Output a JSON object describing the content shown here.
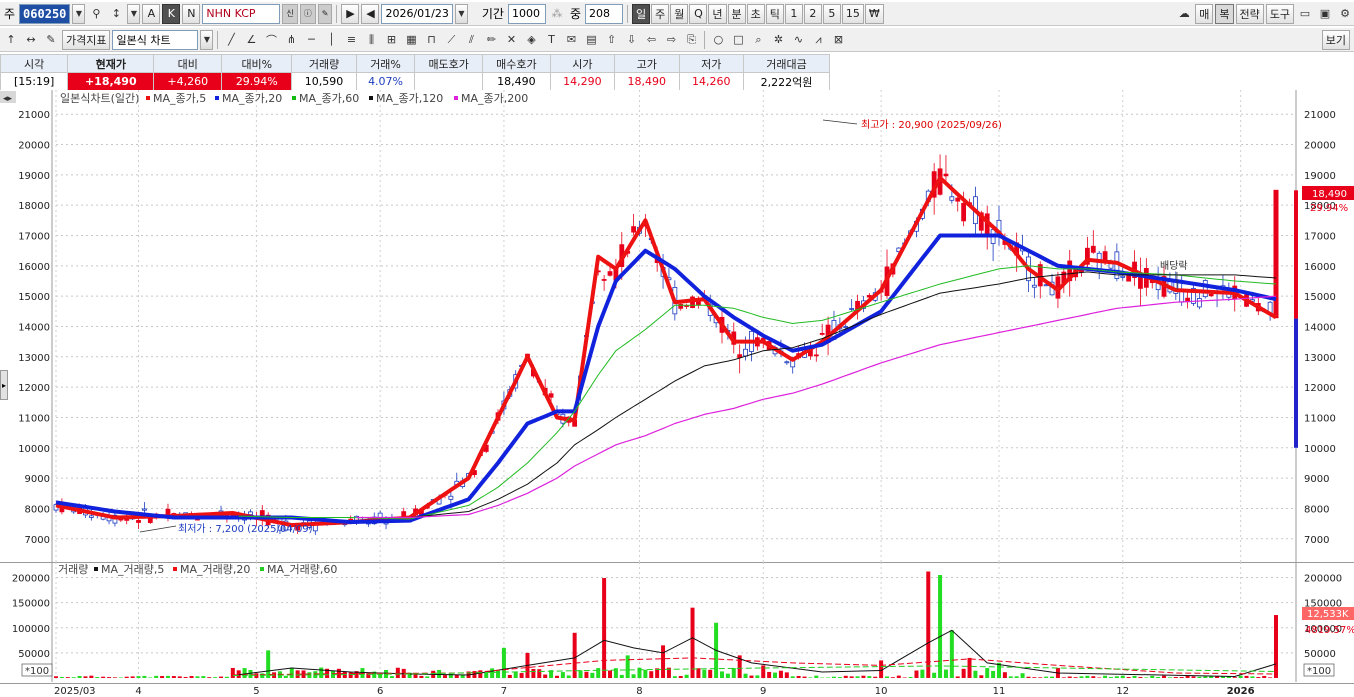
{
  "toolbar": {
    "market_label": "주",
    "stock_code": "060250",
    "stock_name": "NHN KCP",
    "btn_a": "A",
    "btn_k": "K",
    "btn_n": "N",
    "date": "2026/01/23",
    "period_label": "기간",
    "period_value": "1000",
    "count_label": "중",
    "count_value": "208",
    "timeframes": [
      "일",
      "주",
      "월",
      "Q",
      "년",
      "분",
      "초",
      "틱",
      "1",
      "2",
      "5",
      "15",
      "₩"
    ],
    "active_timeframe": "일",
    "right_buttons": [
      "매",
      "복",
      "전략",
      "도구"
    ],
    "price_indicator": "가격지표",
    "chart_type": "일본식 차트",
    "view_button": "보기"
  },
  "quote": {
    "headers": [
      "시각",
      "현재가",
      "대비",
      "대비%",
      "거래량",
      "거래%",
      "매도호가",
      "매수호가",
      "시가",
      "고가",
      "저가",
      "거래대금"
    ],
    "time": "[15:19]",
    "current": "+18,490",
    "change": "+4,260",
    "change_pct": "29.94%",
    "volume": "10,590",
    "volume_pct": "4.07%",
    "ask": "",
    "bid": "18,490",
    "open": "14,290",
    "high": "18,490",
    "low": "14,260",
    "amount": "2,222억원"
  },
  "price_chart": {
    "legend_title": "일본식차트(일간)",
    "legend_items": [
      {
        "name": "MA_종가,5",
        "color": "#ee1111"
      },
      {
        "name": "MA_종가,20",
        "color": "#1122dd"
      },
      {
        "name": "MA_종가,60",
        "color": "#11bb11"
      },
      {
        "name": "MA_종가,120",
        "color": "#111111"
      },
      {
        "name": "MA_종가,200",
        "color": "#dd22dd"
      }
    ],
    "high_annotation": "최고가 : 20,900 (2025/09/26)",
    "low_annotation": "최저가 : 7,200 (2025/04/09)",
    "dividend_label": "배당락",
    "last_price_tag": "18,490",
    "last_pct_tag": "29.94%"
  },
  "volume_chart": {
    "legend_title": "거래량",
    "legend_items": [
      {
        "name": "MA_거래량,5",
        "color": "#111111"
      },
      {
        "name": "MA_거래량,20",
        "color": "#ee1111"
      },
      {
        "name": "MA_거래량,60",
        "color": "#22cc22"
      }
    ],
    "unit_left": "*100",
    "unit_right": "*100",
    "last_volume_tag": "12,533K",
    "last_vol_pct_tag": "4819.57%"
  },
  "chart_data": [
    {
      "type": "line",
      "title": "일본식차트(일간)",
      "ylim": [
        6300,
        21600
      ],
      "y_ticks": [
        7000,
        8000,
        9000,
        10000,
        11000,
        12000,
        13000,
        14000,
        15000,
        16000,
        17000,
        18000,
        19000,
        20000,
        21000
      ],
      "x_ticks": [
        "2025/03",
        "4",
        "5",
        "6",
        "7",
        "8",
        "9",
        "10",
        "11",
        "12",
        "2026"
      ],
      "x": [
        0,
        10,
        20,
        30,
        40,
        50,
        60,
        70,
        75,
        80,
        85,
        88,
        92,
        95,
        100,
        105,
        110,
        115,
        120,
        125,
        130,
        140,
        150,
        160,
        165,
        170,
        175,
        180,
        190,
        200,
        207
      ],
      "series": [
        {
          "name": "MA_종가,5",
          "values": [
            8100,
            7700,
            7750,
            7850,
            7450,
            7550,
            7700,
            9000,
            11000,
            13000,
            11000,
            10900,
            16300,
            15900,
            17500,
            14800,
            14900,
            13500,
            13500,
            12900,
            13500,
            15200,
            18900,
            17100,
            15900,
            15200,
            16200,
            16100,
            15200,
            15100,
            14300
          ]
        },
        {
          "name": "MA_종가,20",
          "values": [
            8200,
            7900,
            7700,
            7700,
            7700,
            7550,
            7600,
            8300,
            9500,
            10800,
            11200,
            11200,
            14000,
            15500,
            16500,
            15900,
            15000,
            14300,
            13700,
            13200,
            13400,
            14500,
            17000,
            17000,
            16500,
            16000,
            15900,
            15800,
            15500,
            15200,
            14900
          ]
        },
        {
          "name": "MA_종가,60",
          "values": [
            null,
            null,
            null,
            7750,
            7700,
            7700,
            7650,
            8100,
            8700,
            9500,
            10500,
            11200,
            12400,
            13200,
            13900,
            14700,
            14700,
            14600,
            14300,
            14100,
            14200,
            14800,
            15400,
            15900,
            16000,
            15900,
            15900,
            15800,
            15700,
            15500,
            15400
          ]
        },
        {
          "name": "MA_종가,120",
          "values": [
            null,
            null,
            null,
            null,
            null,
            7700,
            7700,
            7900,
            8300,
            8800,
            9500,
            10100,
            10600,
            11000,
            11600,
            12200,
            12700,
            12900,
            13200,
            13300,
            13600,
            14400,
            15100,
            15400,
            15600,
            15700,
            15800,
            15700,
            15700,
            15700,
            15600
          ]
        },
        {
          "name": "MA_종가,200",
          "values": [
            null,
            null,
            null,
            null,
            null,
            7700,
            7700,
            7800,
            8100,
            8500,
            9000,
            9400,
            9800,
            10100,
            10400,
            10800,
            11100,
            11300,
            11600,
            11800,
            12100,
            12800,
            13400,
            13800,
            14000,
            14200,
            14400,
            14600,
            14800,
            14900,
            15000
          ]
        }
      ],
      "annotations": {
        "max": 20900,
        "max_date": "2025/09/26",
        "min": 7200,
        "min_date": "2025/04/09",
        "last_close": 18490
      }
    },
    {
      "type": "bar",
      "title": "거래량",
      "ylim": [
        0,
        215000
      ],
      "y_ticks": [
        50000,
        100000,
        150000,
        200000
      ],
      "spikes": [
        {
          "x": 30,
          "value": 20000,
          "color": "red"
        },
        {
          "x": 36,
          "value": 55000,
          "color": "green"
        },
        {
          "x": 42,
          "value": 15000,
          "color": "red"
        },
        {
          "x": 70,
          "value": 13000,
          "color": "red"
        },
        {
          "x": 76,
          "value": 60000,
          "color": "green"
        },
        {
          "x": 80,
          "value": 50000,
          "color": "red"
        },
        {
          "x": 88,
          "value": 90000,
          "color": "red"
        },
        {
          "x": 93,
          "value": 199000,
          "color": "red"
        },
        {
          "x": 97,
          "value": 45000,
          "color": "green"
        },
        {
          "x": 103,
          "value": 65000,
          "color": "red"
        },
        {
          "x": 108,
          "value": 140000,
          "color": "red"
        },
        {
          "x": 112,
          "value": 110000,
          "color": "green"
        },
        {
          "x": 116,
          "value": 45000,
          "color": "red"
        },
        {
          "x": 120,
          "value": 25000,
          "color": "red"
        },
        {
          "x": 140,
          "value": 35000,
          "color": "red"
        },
        {
          "x": 148,
          "value": 212000,
          "color": "red"
        },
        {
          "x": 150,
          "value": 205000,
          "color": "green"
        },
        {
          "x": 152,
          "value": 95000,
          "color": "green"
        },
        {
          "x": 155,
          "value": 40000,
          "color": "red"
        },
        {
          "x": 160,
          "value": 30000,
          "color": "green"
        },
        {
          "x": 170,
          "value": 20000,
          "color": "red"
        },
        {
          "x": 207,
          "value": 125330,
          "color": "red"
        }
      ]
    }
  ]
}
